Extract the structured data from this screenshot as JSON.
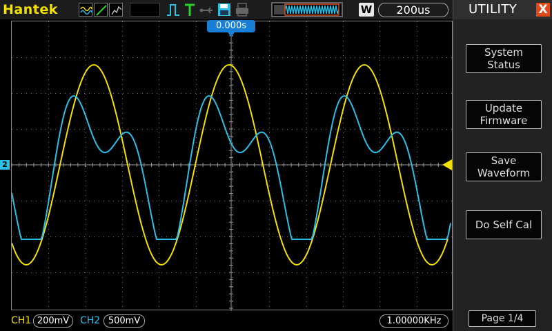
{
  "brand": "Hantek",
  "toolbar": {
    "icons": [
      "waveform-mode-icon",
      "ramp-icon",
      "persist-icon",
      "pulse-trigger-icon",
      "trigger-T-icon",
      "usb-icon",
      "save-icon",
      "print-icon"
    ],
    "record_badge": "W",
    "timebase": "200us"
  },
  "scope": {
    "trigger_position": "0.000s",
    "ch2_marker": "2"
  },
  "bottom": {
    "ch1_label": "CH1",
    "ch1_scale": "200mV",
    "ch2_label": "CH2",
    "ch2_scale": "500mV",
    "frequency": "1.00000KHz"
  },
  "panel": {
    "title": "UTILITY",
    "close_label": "X",
    "buttons": [
      {
        "label": "System\nStatus"
      },
      {
        "label": "Update\nFirmware"
      },
      {
        "label": "Save\nWaveform"
      },
      {
        "label": "Do Self Cal"
      }
    ],
    "page": "Page 1/4"
  },
  "colors": {
    "ch1": "#f3e100",
    "ch2": "#2ac0e8",
    "accent": "#1a7fd4",
    "close": "#e04a1a"
  }
}
